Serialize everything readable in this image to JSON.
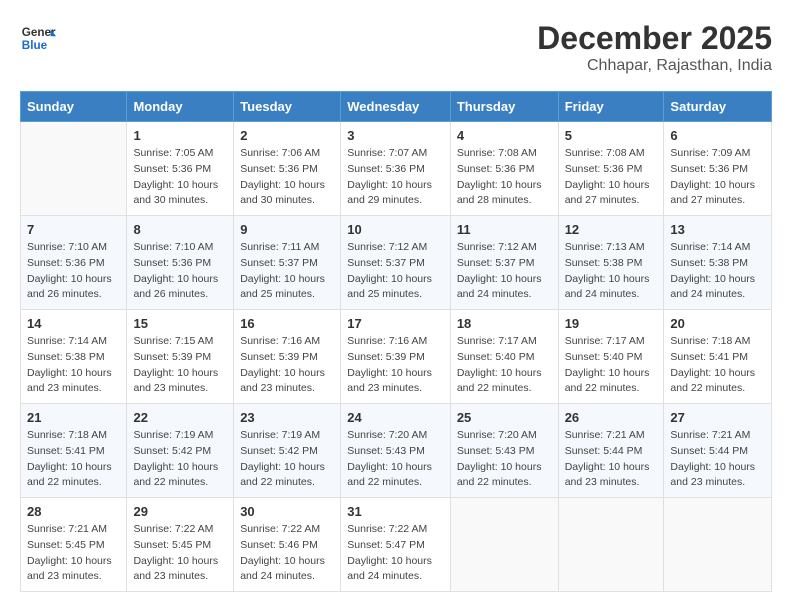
{
  "header": {
    "logo_line1": "General",
    "logo_line2": "Blue",
    "month": "December 2025",
    "location": "Chhapar, Rajasthan, India"
  },
  "weekdays": [
    "Sunday",
    "Monday",
    "Tuesday",
    "Wednesday",
    "Thursday",
    "Friday",
    "Saturday"
  ],
  "weeks": [
    [
      {
        "day": "",
        "empty": true
      },
      {
        "day": "1",
        "sunrise": "7:05 AM",
        "sunset": "5:36 PM",
        "daylight": "10 hours and 30 minutes."
      },
      {
        "day": "2",
        "sunrise": "7:06 AM",
        "sunset": "5:36 PM",
        "daylight": "10 hours and 30 minutes."
      },
      {
        "day": "3",
        "sunrise": "7:07 AM",
        "sunset": "5:36 PM",
        "daylight": "10 hours and 29 minutes."
      },
      {
        "day": "4",
        "sunrise": "7:08 AM",
        "sunset": "5:36 PM",
        "daylight": "10 hours and 28 minutes."
      },
      {
        "day": "5",
        "sunrise": "7:08 AM",
        "sunset": "5:36 PM",
        "daylight": "10 hours and 27 minutes."
      },
      {
        "day": "6",
        "sunrise": "7:09 AM",
        "sunset": "5:36 PM",
        "daylight": "10 hours and 27 minutes."
      }
    ],
    [
      {
        "day": "7",
        "sunrise": "7:10 AM",
        "sunset": "5:36 PM",
        "daylight": "10 hours and 26 minutes."
      },
      {
        "day": "8",
        "sunrise": "7:10 AM",
        "sunset": "5:36 PM",
        "daylight": "10 hours and 26 minutes."
      },
      {
        "day": "9",
        "sunrise": "7:11 AM",
        "sunset": "5:37 PM",
        "daylight": "10 hours and 25 minutes."
      },
      {
        "day": "10",
        "sunrise": "7:12 AM",
        "sunset": "5:37 PM",
        "daylight": "10 hours and 25 minutes."
      },
      {
        "day": "11",
        "sunrise": "7:12 AM",
        "sunset": "5:37 PM",
        "daylight": "10 hours and 24 minutes."
      },
      {
        "day": "12",
        "sunrise": "7:13 AM",
        "sunset": "5:38 PM",
        "daylight": "10 hours and 24 minutes."
      },
      {
        "day": "13",
        "sunrise": "7:14 AM",
        "sunset": "5:38 PM",
        "daylight": "10 hours and 24 minutes."
      }
    ],
    [
      {
        "day": "14",
        "sunrise": "7:14 AM",
        "sunset": "5:38 PM",
        "daylight": "10 hours and 23 minutes."
      },
      {
        "day": "15",
        "sunrise": "7:15 AM",
        "sunset": "5:39 PM",
        "daylight": "10 hours and 23 minutes."
      },
      {
        "day": "16",
        "sunrise": "7:16 AM",
        "sunset": "5:39 PM",
        "daylight": "10 hours and 23 minutes."
      },
      {
        "day": "17",
        "sunrise": "7:16 AM",
        "sunset": "5:39 PM",
        "daylight": "10 hours and 23 minutes."
      },
      {
        "day": "18",
        "sunrise": "7:17 AM",
        "sunset": "5:40 PM",
        "daylight": "10 hours and 22 minutes."
      },
      {
        "day": "19",
        "sunrise": "7:17 AM",
        "sunset": "5:40 PM",
        "daylight": "10 hours and 22 minutes."
      },
      {
        "day": "20",
        "sunrise": "7:18 AM",
        "sunset": "5:41 PM",
        "daylight": "10 hours and 22 minutes."
      }
    ],
    [
      {
        "day": "21",
        "sunrise": "7:18 AM",
        "sunset": "5:41 PM",
        "daylight": "10 hours and 22 minutes."
      },
      {
        "day": "22",
        "sunrise": "7:19 AM",
        "sunset": "5:42 PM",
        "daylight": "10 hours and 22 minutes."
      },
      {
        "day": "23",
        "sunrise": "7:19 AM",
        "sunset": "5:42 PM",
        "daylight": "10 hours and 22 minutes."
      },
      {
        "day": "24",
        "sunrise": "7:20 AM",
        "sunset": "5:43 PM",
        "daylight": "10 hours and 22 minutes."
      },
      {
        "day": "25",
        "sunrise": "7:20 AM",
        "sunset": "5:43 PM",
        "daylight": "10 hours and 22 minutes."
      },
      {
        "day": "26",
        "sunrise": "7:21 AM",
        "sunset": "5:44 PM",
        "daylight": "10 hours and 23 minutes."
      },
      {
        "day": "27",
        "sunrise": "7:21 AM",
        "sunset": "5:44 PM",
        "daylight": "10 hours and 23 minutes."
      }
    ],
    [
      {
        "day": "28",
        "sunrise": "7:21 AM",
        "sunset": "5:45 PM",
        "daylight": "10 hours and 23 minutes."
      },
      {
        "day": "29",
        "sunrise": "7:22 AM",
        "sunset": "5:45 PM",
        "daylight": "10 hours and 23 minutes."
      },
      {
        "day": "30",
        "sunrise": "7:22 AM",
        "sunset": "5:46 PM",
        "daylight": "10 hours and 24 minutes."
      },
      {
        "day": "31",
        "sunrise": "7:22 AM",
        "sunset": "5:47 PM",
        "daylight": "10 hours and 24 minutes."
      },
      {
        "day": "",
        "empty": true
      },
      {
        "day": "",
        "empty": true
      },
      {
        "day": "",
        "empty": true
      }
    ]
  ]
}
